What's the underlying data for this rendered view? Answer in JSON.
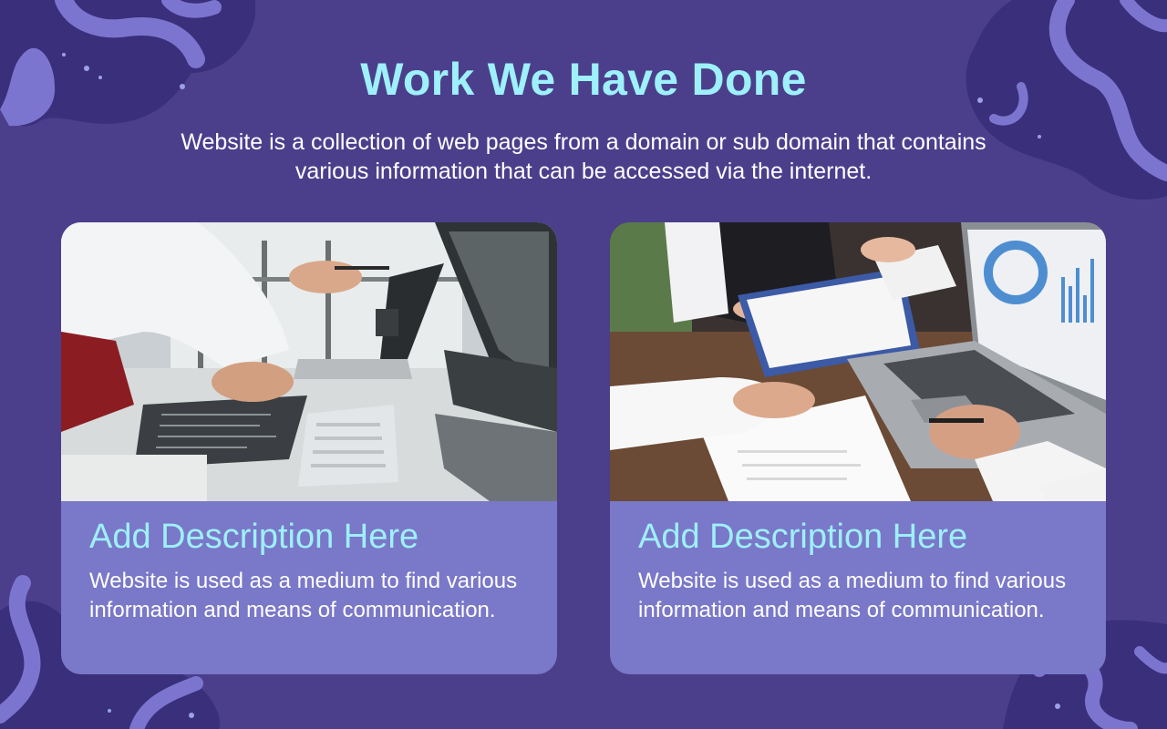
{
  "slide": {
    "title": "Work We Have Done",
    "subtitle": "Website is a collection of web pages from a domain or sub domain that contains various information that can be accessed via the internet."
  },
  "cards": [
    {
      "image": "office-meeting-laptops-photo",
      "title": "Add Description Here",
      "description": "Website is used as a medium to find various information and means of communication."
    },
    {
      "image": "business-analytics-laptop-photo",
      "title": "Add Description Here",
      "description": "Website is used as a medium to find various information and means of communication."
    }
  ],
  "colors": {
    "background": "#4b3f8c",
    "title": "#9ef0fb",
    "card": "#7a78c8",
    "blob_dark": "#3a2f7a",
    "blob_light": "#7c75d0"
  }
}
